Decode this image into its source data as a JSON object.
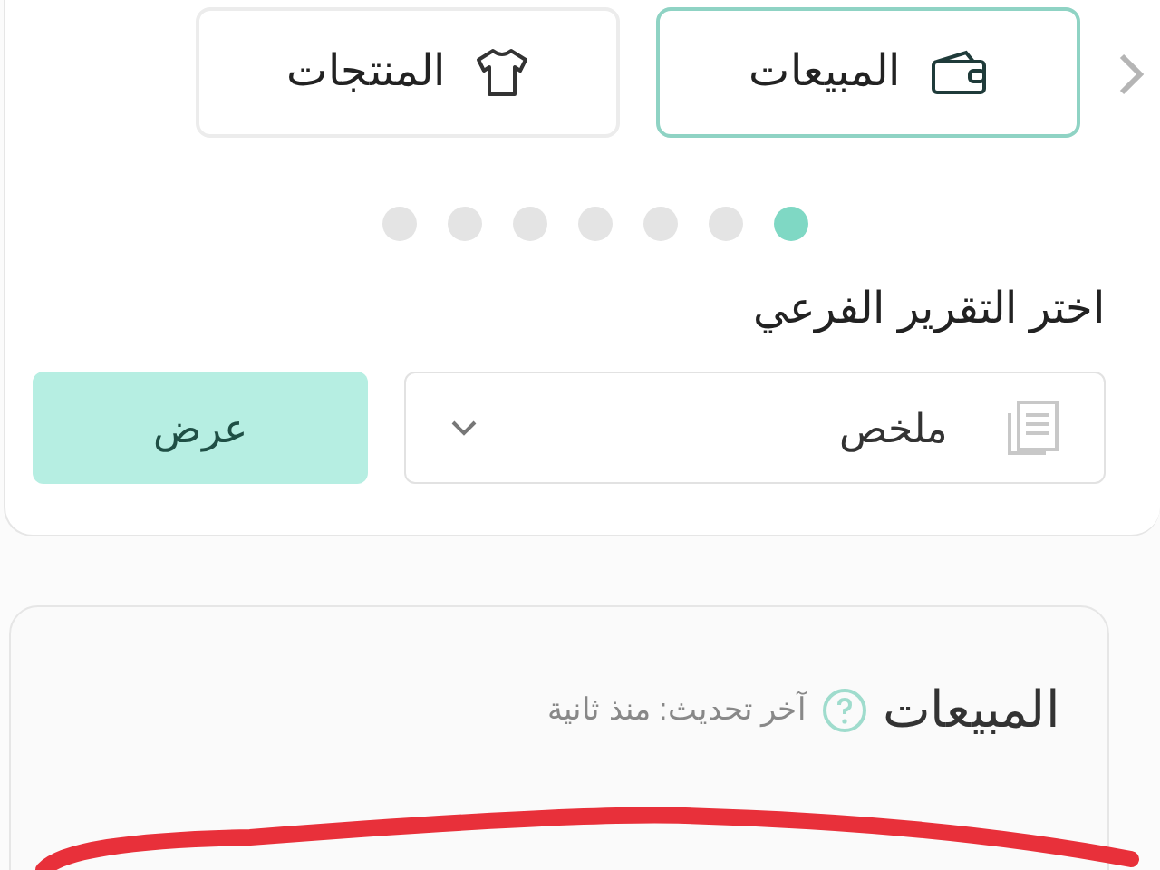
{
  "tabs": [
    {
      "label": "المبيعات",
      "kind": "wallet",
      "selected": true
    },
    {
      "label": "المنتجات",
      "kind": "shirt",
      "selected": false
    }
  ],
  "carousel_dots": [
    {
      "selected": true
    },
    {
      "selected": false
    },
    {
      "selected": false
    },
    {
      "selected": false
    },
    {
      "selected": false
    },
    {
      "selected": false
    },
    {
      "selected": false
    }
  ],
  "subreport": {
    "label": "اختر التقرير الفرعي",
    "value": "ملخص",
    "button": "عرض"
  },
  "card": {
    "title": "المبيعات",
    "updated": "آخر تحديث: منذ ثانية"
  }
}
